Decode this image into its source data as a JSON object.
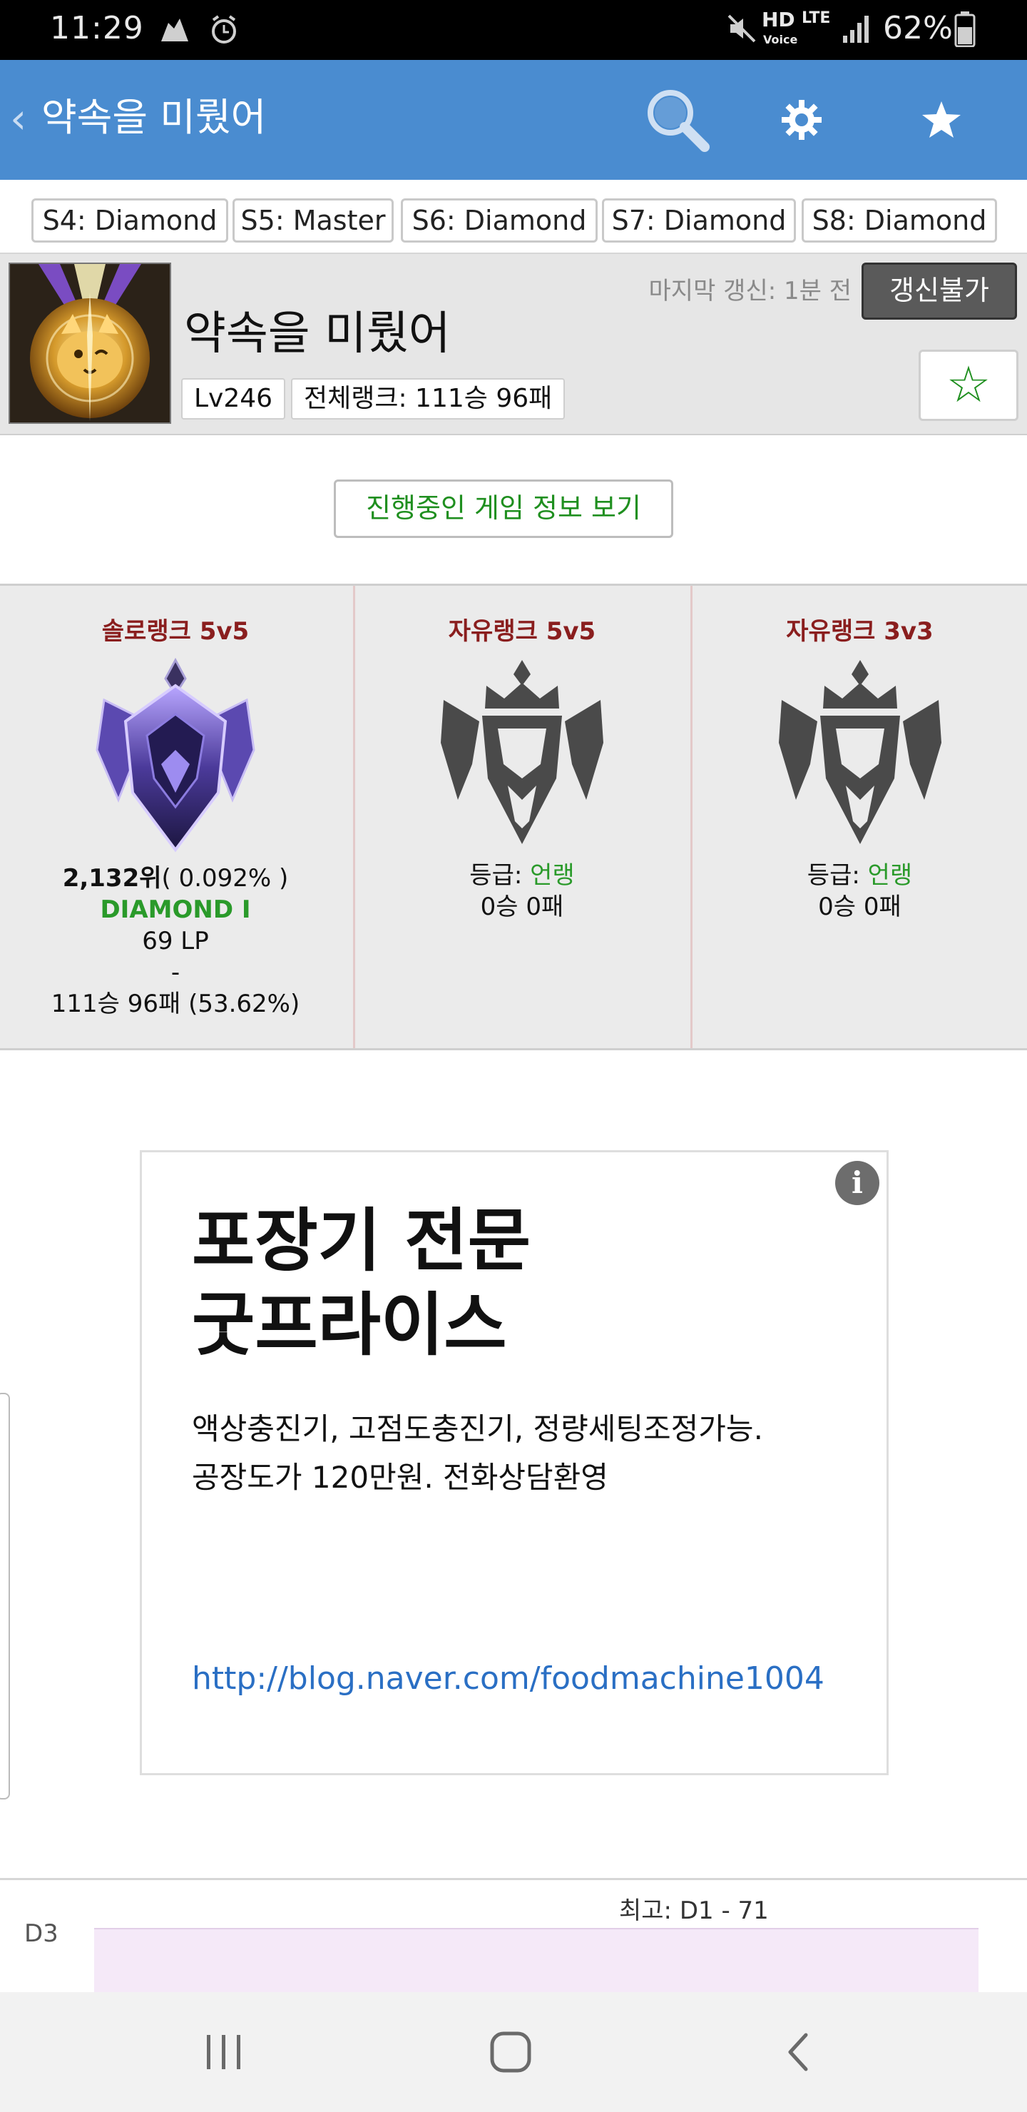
{
  "status_bar": {
    "time": "11:29",
    "hd_label": "HD",
    "voice_label": "Voice",
    "lte_label": "LTE",
    "battery": "62%"
  },
  "app_bar": {
    "title": "약속을 미뤘어",
    "back_icon": "chevron-left-icon",
    "search_icon": "search-icon",
    "settings_icon": "gear-icon",
    "favorites_icon": "star-icon"
  },
  "seasons": [
    {
      "label": "S4: Diamond"
    },
    {
      "label": "S5: Master"
    },
    {
      "label": "S6: Diamond"
    },
    {
      "label": "S7: Diamond"
    },
    {
      "label": "S8: Diamond"
    }
  ],
  "profile": {
    "name": "약속을 미뤘어",
    "level": "Lv246",
    "overall_rank": "전체랭크: 111승 96패",
    "last_update": "마지막 갱신: 1분 전",
    "renew_button": "갱신불가",
    "favorite_glyph": "☆"
  },
  "live_game_button": "진행중인 게임 정보 보기",
  "ranks": {
    "solo": {
      "title": "솔로랭크 5v5",
      "position_rank": "2,132위",
      "position_pct": "( 0.092% )",
      "tier": "DIAMOND I",
      "lp": "69 LP",
      "dash": "-",
      "record": "111승 96패 (53.62%)"
    },
    "flex5": {
      "title": "자유랭크 5v5",
      "grade_label": "등급: ",
      "grade_value": "언랭",
      "record": "0승 0패"
    },
    "flex3": {
      "title": "자유랭크 3v3",
      "grade_label": "등급: ",
      "grade_value": "언랭",
      "record": "0승 0패"
    }
  },
  "ad": {
    "info_glyph": "i",
    "headline_line1": "포장기 전문",
    "headline_line2": "굿프라이스",
    "body_line1": "액상충진기, 고점도충진기, 정량세팅조정가능.",
    "body_line2": "공장도가 120만원. 전화상담환영",
    "link": "http://blog.naver.com/foodmachine1004"
  },
  "graph": {
    "max_label": "최고: D1 - 71",
    "tier_label": "D3"
  },
  "nav_bar": {
    "recents_icon": "recents-icon",
    "home_icon": "home-icon",
    "back_icon": "back-icon"
  },
  "colors": {
    "app_bar": "#4a8cd0",
    "accent_green": "#2a9a2a",
    "rank_title": "#8a1e1e",
    "link": "#2a6fc4"
  }
}
